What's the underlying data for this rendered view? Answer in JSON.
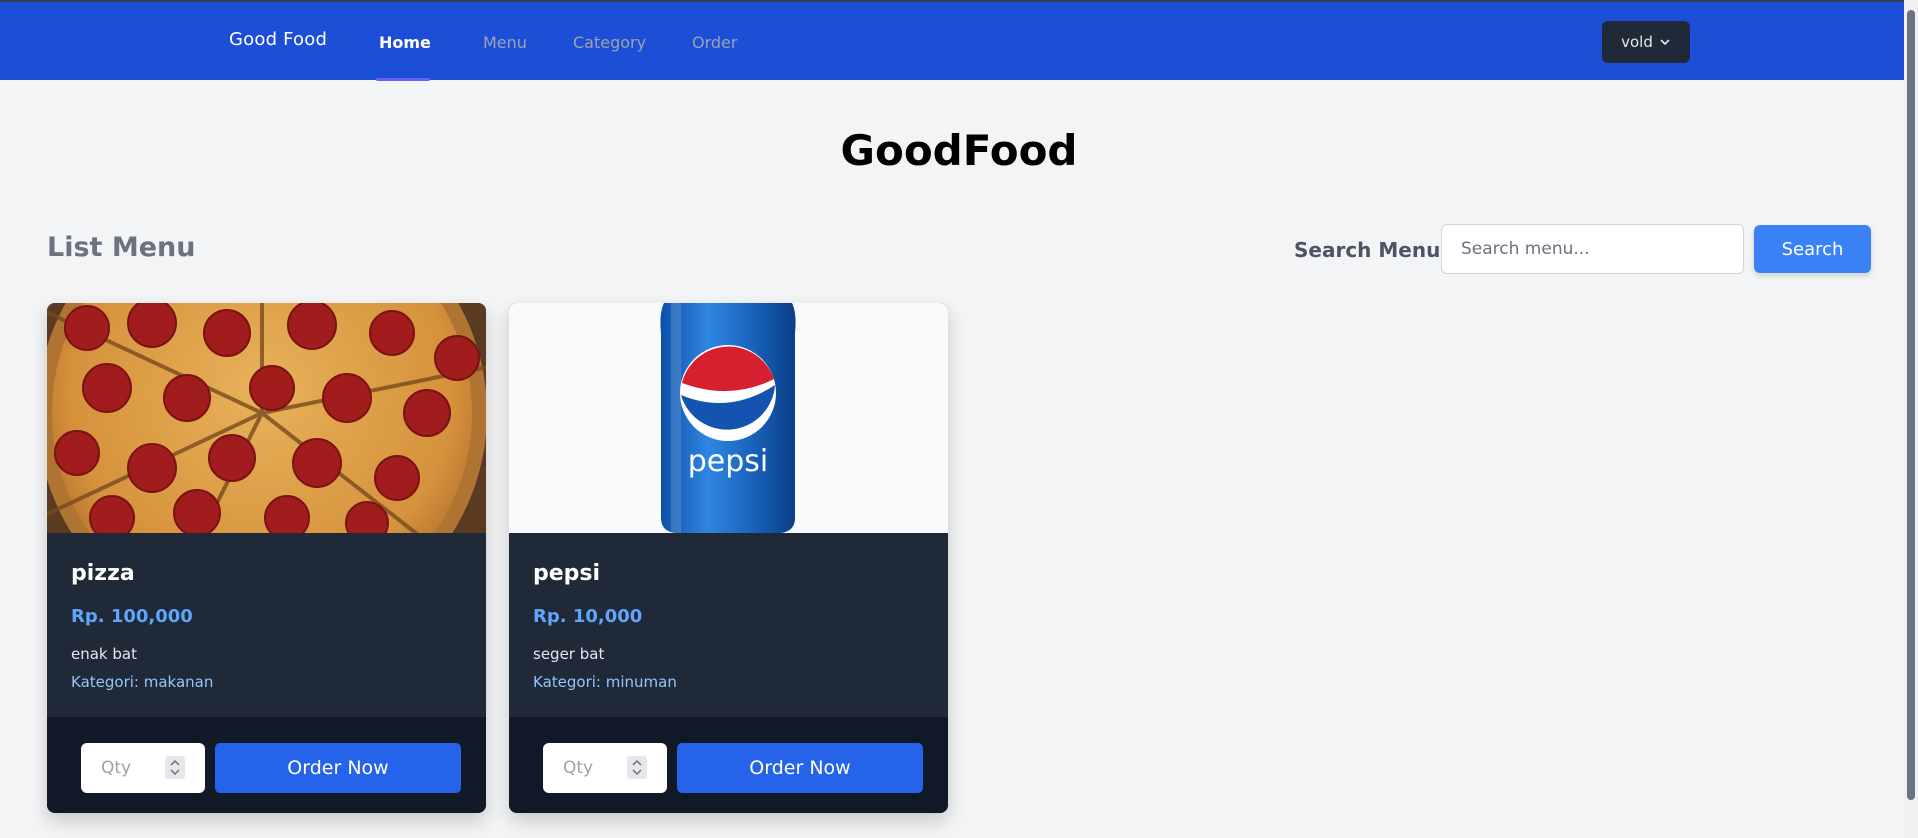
{
  "nav": {
    "brand": "Good Food",
    "links": [
      {
        "label": "Home",
        "active": true
      },
      {
        "label": "Menu",
        "active": false
      },
      {
        "label": "Category",
        "active": false
      },
      {
        "label": "Order",
        "active": false
      }
    ],
    "user": "vold",
    "user_icon": "chevron-down-icon"
  },
  "header": {
    "title": "GoodFood"
  },
  "list": {
    "title": "List Menu",
    "search_label": "Search Menu",
    "search_placeholder": "Search menu...",
    "search_value": "",
    "search_button": "Search"
  },
  "menu_items": [
    {
      "name": "pizza",
      "price": "Rp. 100,000",
      "description": "enak bat",
      "category": "Kategori: makanan",
      "image": "pepperoni-pizza-photo",
      "qty_placeholder": "Qty",
      "order_label": "Order Now"
    },
    {
      "name": "pepsi",
      "price": "Rp. 10,000",
      "description": "seger bat",
      "category": "Kategori: minuman",
      "image": "pepsi-can-photo",
      "qty_placeholder": "Qty",
      "order_label": "Order Now"
    }
  ],
  "colors": {
    "navbar": "#1d4ed8",
    "primary_button": "#2563eb",
    "search_button": "#3b82f6",
    "card_body": "#1f2937",
    "card_footer": "#111827",
    "price": "#60a5fa"
  }
}
